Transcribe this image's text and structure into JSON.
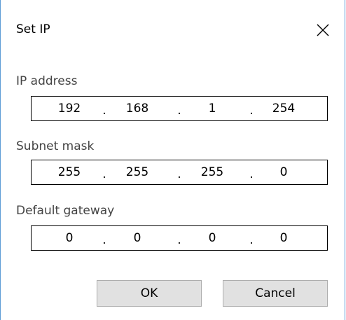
{
  "dialog": {
    "title": "Set IP",
    "close_icon": "close-icon"
  },
  "ip_address": {
    "label": "IP address",
    "octets": [
      "192",
      "168",
      "1",
      "254"
    ],
    "separator": "."
  },
  "subnet_mask": {
    "label": "Subnet mask",
    "octets": [
      "255",
      "255",
      "255",
      "0"
    ],
    "separator": "."
  },
  "default_gateway": {
    "label": "Default gateway",
    "octets": [
      "0",
      "0",
      "0",
      "0"
    ],
    "separator": "."
  },
  "buttons": {
    "ok_label": "OK",
    "cancel_label": "Cancel"
  },
  "colors": {
    "window_border": "#5b9bd5",
    "button_face": "#e1e1e1",
    "button_border": "#adadad",
    "label_text": "#444444"
  }
}
